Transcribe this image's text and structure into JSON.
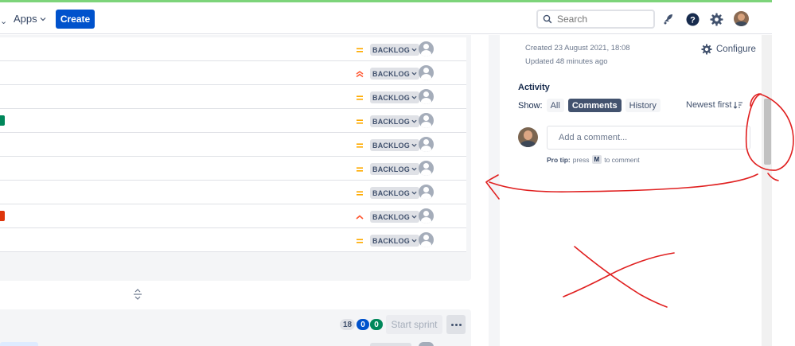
{
  "topbar": {
    "apps_label": "Apps",
    "create_label": "Create",
    "search_placeholder": "Search"
  },
  "backlog": {
    "rows": [
      {
        "priority": "medium",
        "status": "BACKLOG",
        "tag": null
      },
      {
        "priority": "highest",
        "status": "BACKLOG",
        "tag": null
      },
      {
        "priority": "medium",
        "status": "BACKLOG",
        "tag": null
      },
      {
        "priority": "medium",
        "status": "BACKLOG",
        "tag": "green"
      },
      {
        "priority": "medium",
        "status": "BACKLOG",
        "tag": null
      },
      {
        "priority": "medium",
        "status": "BACKLOG",
        "tag": null
      },
      {
        "priority": "medium",
        "status": "BACKLOG",
        "tag": null
      },
      {
        "priority": "high",
        "status": "BACKLOG",
        "tag": "red"
      },
      {
        "priority": "medium",
        "status": "BACKLOG",
        "tag": null
      }
    ]
  },
  "sprint": {
    "count_total": "18",
    "count_in_progress": "0",
    "count_done": "0",
    "start_label": "Start sprint"
  },
  "issue_panel": {
    "created": "Created 23 August 2021, 18:08",
    "updated": "Updated 48 minutes ago",
    "configure_label": "Configure",
    "activity_title": "Activity",
    "show_label": "Show:",
    "filters": [
      "All",
      "Comments",
      "History"
    ],
    "active_filter": "Comments",
    "sort_label": "Newest first",
    "comment_placeholder": "Add a comment...",
    "protip_label": "Pro tip:",
    "protip_press": "press",
    "protip_key": "M",
    "protip_suffix": "to comment"
  },
  "colors": {
    "brand": "#0052cc",
    "priority_medium": "#ffab00",
    "priority_high": "#ff5630",
    "annotation": "#e02020"
  }
}
